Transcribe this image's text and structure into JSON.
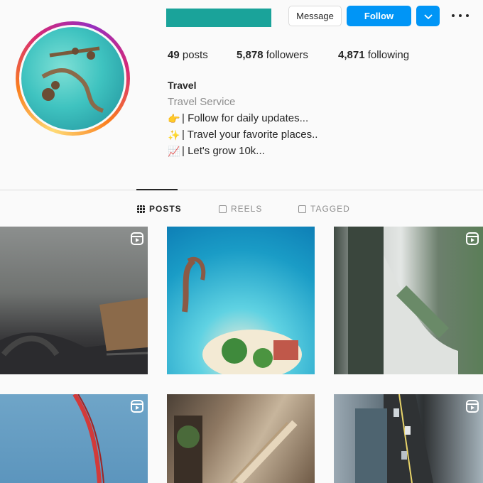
{
  "profile": {
    "stats": {
      "posts_count": "49",
      "posts_label": "posts",
      "followers_count": "5,878",
      "followers_label": "followers",
      "following_count": "4,871",
      "following_label": "following"
    },
    "bio": {
      "name": "Travel",
      "category": "Travel Service",
      "lines": [
        {
          "emoji": "👉",
          "text": "| Follow for daily updates..."
        },
        {
          "emoji": "✨",
          "text": "| Travel your favorite places.."
        },
        {
          "emoji": "📈",
          "text": "| Let's grow 10k..."
        }
      ]
    }
  },
  "actions": {
    "message_label": "Message",
    "follow_label": "Follow",
    "dropdown_icon": "chevron-down-icon",
    "more_icon": "more-options-icon"
  },
  "tabs": [
    {
      "label": "POSTS",
      "icon": "grid-icon",
      "active": true
    },
    {
      "label": "REELS",
      "icon": "reels-icon",
      "active": false
    },
    {
      "label": "TAGGED",
      "icon": "tagged-icon",
      "active": false
    }
  ],
  "posts": [
    {
      "type": "reel"
    },
    {
      "type": "image"
    },
    {
      "type": "reel"
    },
    {
      "type": "reel"
    },
    {
      "type": "image"
    },
    {
      "type": "reel"
    }
  ],
  "colors": {
    "accent": "#0095f6",
    "username_redaction": "#1aa39a",
    "text": "#262626",
    "muted": "#8e8e8e"
  }
}
